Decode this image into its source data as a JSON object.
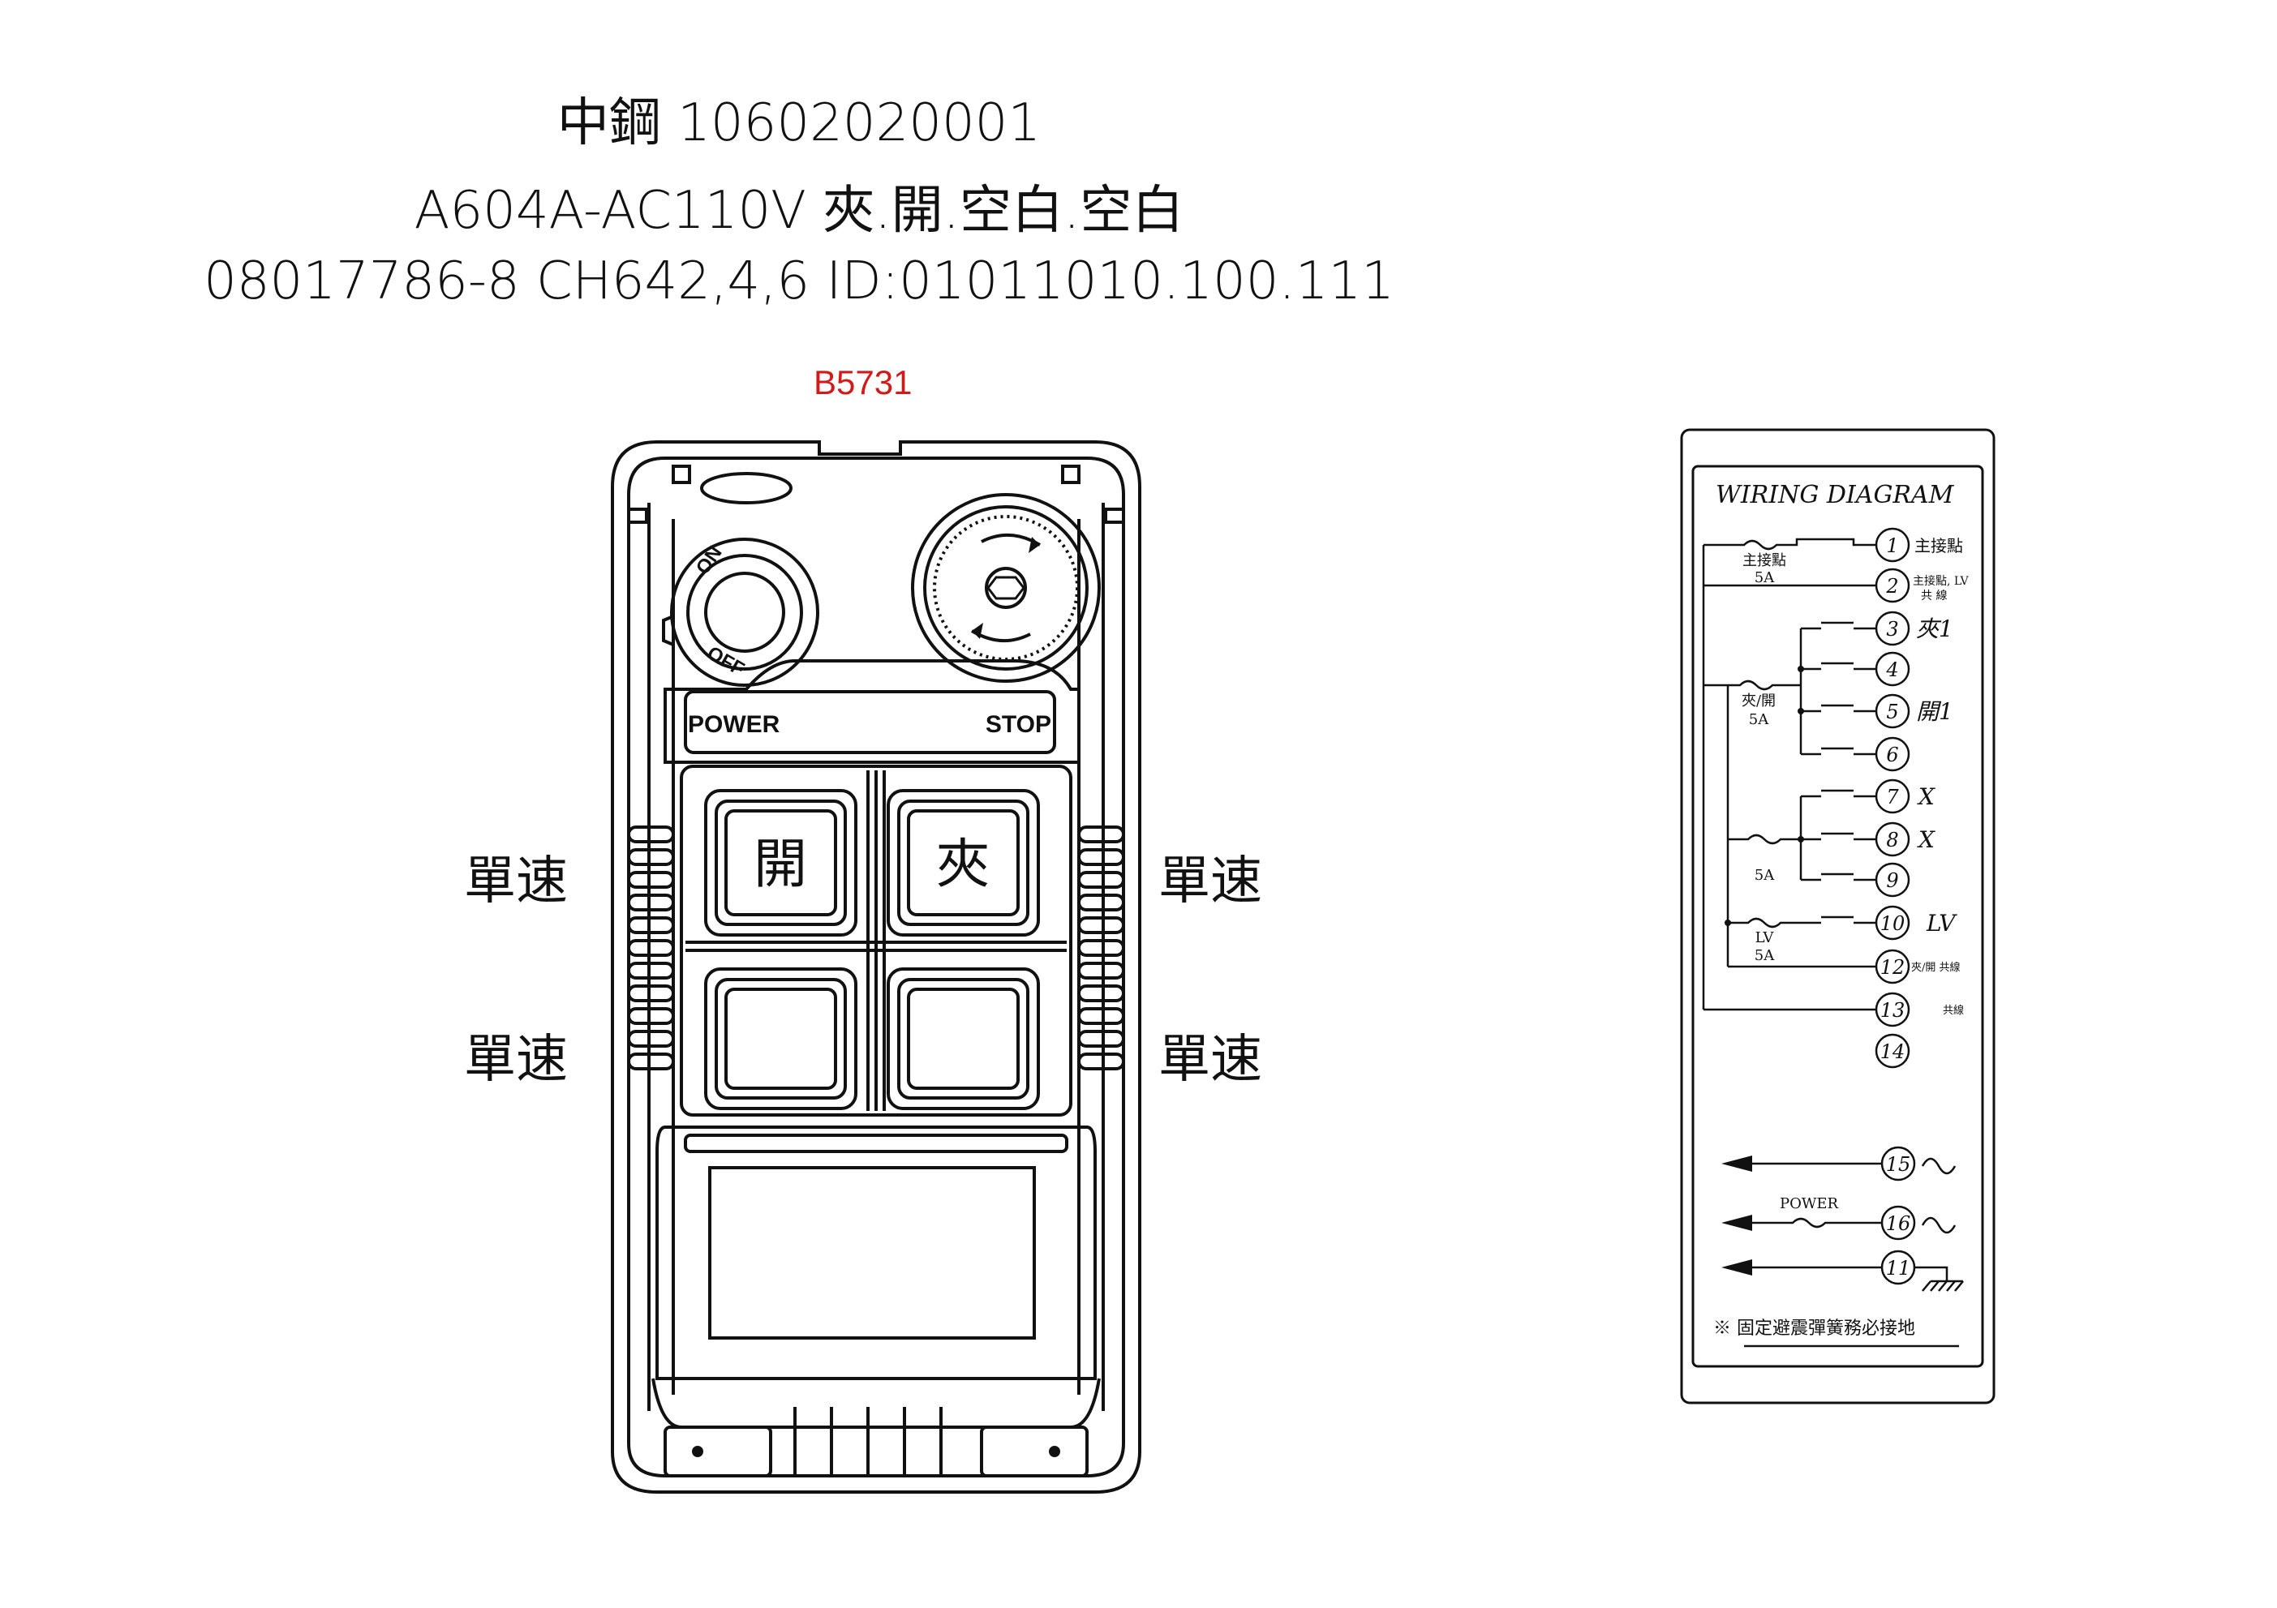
{
  "header": {
    "line1": "中鋼  10602020001",
    "line2": "A604A-AC110V 夾.開.空白.空白",
    "line3": "08017786-8 CH642,4,6 ID:01011010.100.111",
    "code": "B5731"
  },
  "pendant": {
    "switch_on": "ON",
    "switch_off": "OFF",
    "label_power": "POWER",
    "label_stop": "STOP",
    "buttons": [
      {
        "text": "開"
      },
      {
        "text": "夾"
      },
      {
        "text": ""
      },
      {
        "text": ""
      }
    ],
    "side_labels": {
      "left_top": "單速",
      "left_bottom": "單速",
      "right_top": "單速",
      "right_bottom": "單速"
    }
  },
  "wiring": {
    "title": "WIRING DIAGRAM",
    "terminals": [
      "1",
      "2",
      "3",
      "4",
      "5",
      "6",
      "7",
      "8",
      "9",
      "10",
      "12",
      "13",
      "14",
      "15",
      "16",
      "11"
    ],
    "labels": {
      "t1": "主接點",
      "t2a": "主接點, LV",
      "t2b": "共 線",
      "t3": "夾1",
      "t5": "開1",
      "t7": "X",
      "t8": "X",
      "t10": "LV",
      "t12": "夾/開 共線",
      "t13": "共線"
    },
    "fuses": {
      "f1_name": "主接點",
      "f1_rating": "5A",
      "f2_name": "夾/開",
      "f2_rating": "5A",
      "f3_rating": "5A",
      "f4_name": "LV",
      "f4_rating": "5A",
      "power": "POWER"
    },
    "note": "※  固定避震彈簧務必接地"
  }
}
